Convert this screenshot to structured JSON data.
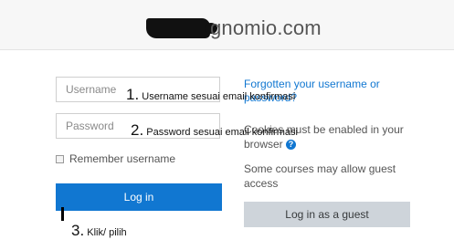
{
  "header": {
    "logo_text": "gnomio.com"
  },
  "form": {
    "username_placeholder": "Username",
    "password_placeholder": "Password",
    "remember_label": "Remember username",
    "login_label": "Log in"
  },
  "annotations": {
    "note1_number": "1.",
    "note1_text": "Username sesuai email konfirmasi",
    "note2_number": "2.",
    "note2_text": "Password sesuai email konfirmasi",
    "note3_number": "3.",
    "note3_text": "Klik/ pilih"
  },
  "side": {
    "forgot_link": "Forgotten your username or password?",
    "cookies_text": "Cookies must be enabled in your browser",
    "help_icon": "?",
    "guest_info": "Some courses may allow guest access",
    "guest_button": "Log in as a guest"
  }
}
